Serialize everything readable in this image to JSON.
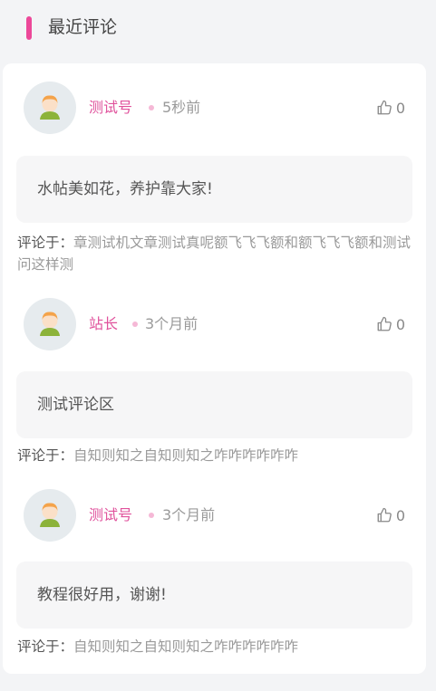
{
  "header": {
    "title": "最近评论"
  },
  "comments": [
    {
      "user": "测试号",
      "time": "5秒前",
      "likes": "0",
      "text": "水帖美如花，养护靠大家!",
      "on_label": "评论于：",
      "on_title": "章测试机文章测试真呢额飞飞飞额和额飞飞飞额和测试问这样测"
    },
    {
      "user": "站长",
      "time": "3个月前",
      "likes": "0",
      "text": "测试评论区",
      "on_label": "评论于：",
      "on_title": "自知则知之自知则知之咋咋咋咋咋咋"
    },
    {
      "user": "测试号",
      "time": "3个月前",
      "likes": "0",
      "text": "教程很好用，谢谢!",
      "on_label": "评论于：",
      "on_title": "自知则知之自知则知之咋咋咋咋咋咋"
    }
  ],
  "colors": {
    "accent": "#ec4899",
    "name": "#e0529c",
    "muted": "#9a9a9a"
  },
  "icons": {
    "avatar": "user-avatar-icon",
    "like": "thumbs-up-icon"
  }
}
